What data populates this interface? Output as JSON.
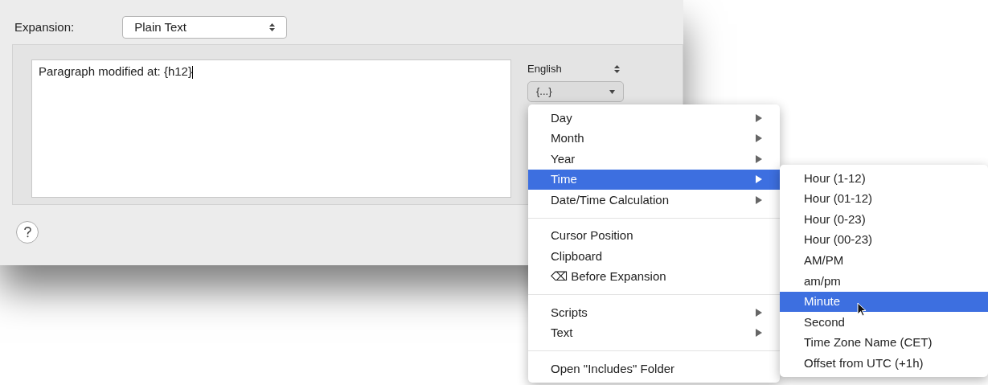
{
  "expansion": {
    "label": "Expansion:",
    "value": "Plain Text"
  },
  "editor": {
    "value": "Paragraph modified at: {h12}"
  },
  "language": {
    "value": "English"
  },
  "insert_popup": {
    "value": "{...}"
  },
  "menu": {
    "sections": [
      [
        {
          "label": "Day",
          "has_submenu": true,
          "selected": false
        },
        {
          "label": "Month",
          "has_submenu": true,
          "selected": false
        },
        {
          "label": "Year",
          "has_submenu": true,
          "selected": false
        },
        {
          "label": "Time",
          "has_submenu": true,
          "selected": true
        },
        {
          "label": "Date/Time Calculation",
          "has_submenu": true,
          "selected": false
        }
      ],
      [
        {
          "label": "Cursor Position",
          "has_submenu": false,
          "selected": false
        },
        {
          "label": "Clipboard",
          "has_submenu": false,
          "selected": false
        },
        {
          "label": "⌫ Before Expansion",
          "has_submenu": false,
          "selected": false
        }
      ],
      [
        {
          "label": "Scripts",
          "has_submenu": true,
          "selected": false
        },
        {
          "label": "Text",
          "has_submenu": true,
          "selected": false
        }
      ],
      [
        {
          "label": "Open \"Includes\" Folder",
          "has_submenu": false,
          "selected": false
        }
      ]
    ]
  },
  "submenu": {
    "items": [
      {
        "label": "Hour (1-12)",
        "selected": false
      },
      {
        "label": "Hour (01-12)",
        "selected": false
      },
      {
        "label": "Hour (0-23)",
        "selected": false
      },
      {
        "label": "Hour (00-23)",
        "selected": false
      },
      {
        "label": "AM/PM",
        "selected": false
      },
      {
        "label": "am/pm",
        "selected": false
      },
      {
        "label": "Minute",
        "selected": true
      },
      {
        "label": "Second",
        "selected": false
      },
      {
        "label": "Time Zone Name (CET)",
        "selected": false
      },
      {
        "label": "Offset from UTC (+1h)",
        "selected": false
      }
    ]
  }
}
